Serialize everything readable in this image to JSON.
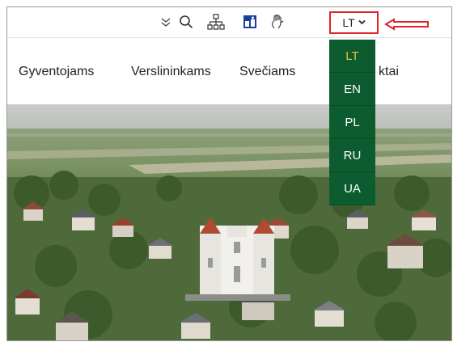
{
  "topbar": {
    "icons": [
      "double-chevron-down-icon",
      "search-icon",
      "sitemap-icon",
      "accessibility-icon",
      "sign-language-icon"
    ],
    "language_selected": "LT"
  },
  "nav": {
    "items": [
      "Gyventojams",
      "Verslininkams",
      "Svečiams",
      "ktai"
    ]
  },
  "language_menu": {
    "options": [
      "LT",
      "EN",
      "PL",
      "RU",
      "UA"
    ],
    "active": "LT"
  },
  "colors": {
    "dropdown_bg": "#0d5c30",
    "active_lang": "#e8c34a",
    "highlight_border": "#e0242a"
  }
}
